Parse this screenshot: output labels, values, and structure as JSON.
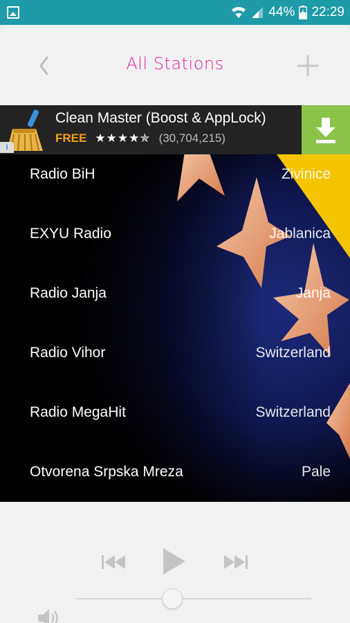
{
  "status_bar": {
    "battery": "44%",
    "time": "22:29"
  },
  "header": {
    "title": "All Stations"
  },
  "ad": {
    "title": "Clean Master (Boost & AppLock)",
    "price": "FREE",
    "stars": "★★★★✯",
    "rating_fraction": 0.9,
    "reviews": "(30,704,215)",
    "info_label": "i",
    "colors": {
      "price": "#f0a020",
      "download": "#8bc34a"
    }
  },
  "stations": [
    {
      "name": "Radio BiH",
      "location": "Zivinice"
    },
    {
      "name": "EXYU Radio",
      "location": "Jablanica"
    },
    {
      "name": "Radio Janja",
      "location": "Janja"
    },
    {
      "name": "Radio Vihor",
      "location": "Switzerland"
    },
    {
      "name": "Radio MegaHit",
      "location": "Switzerland"
    },
    {
      "name": "Otvorena Srpska Mreza",
      "location": "Pale"
    }
  ],
  "player": {
    "volume_level": 0.41,
    "icons": [
      "previous-icon",
      "play-icon",
      "next-icon",
      "volume-icon"
    ]
  },
  "theme": {
    "status_bar": "#1e9aa8",
    "accent": "#e0209c"
  }
}
